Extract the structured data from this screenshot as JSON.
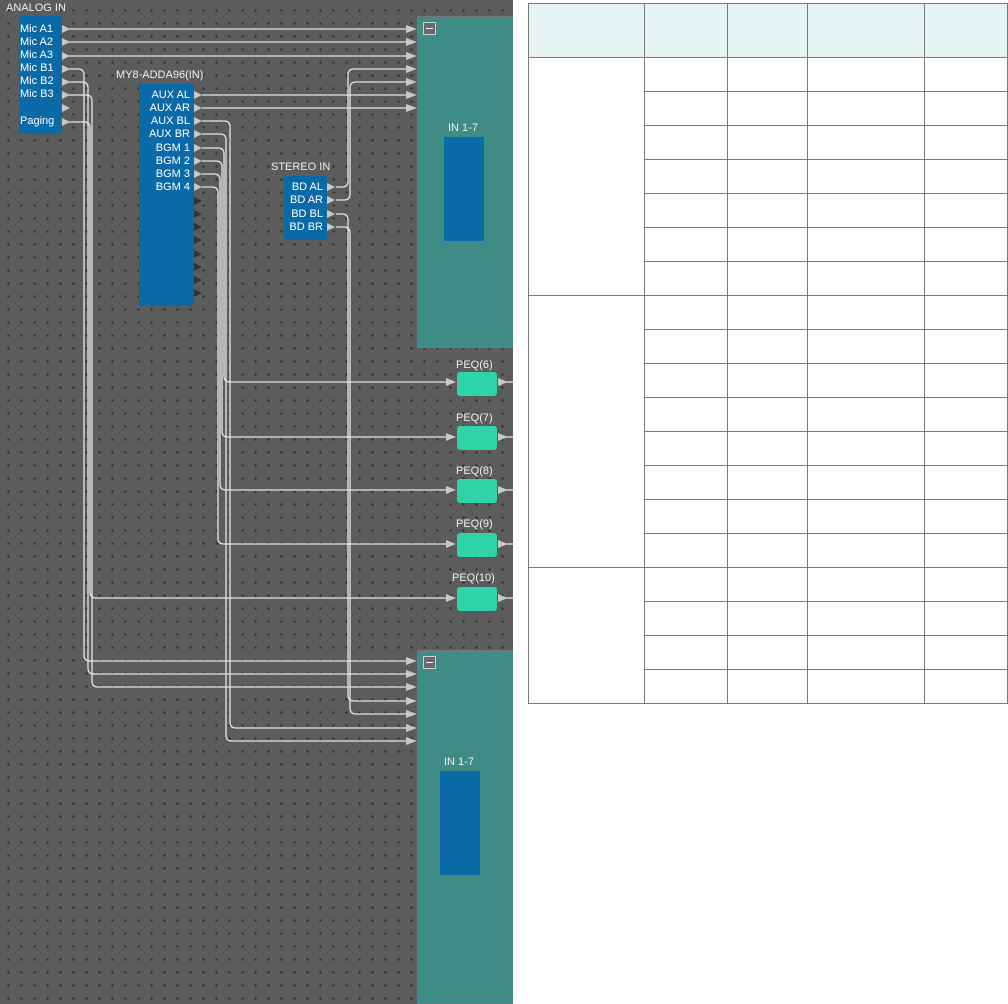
{
  "canvas": {
    "analog_in": {
      "title": "ANALOG IN",
      "ports": [
        "Mic A1",
        "Mic A2",
        "Mic A3",
        "Mic B1",
        "Mic B2",
        "Mic B3",
        "",
        "Paging"
      ]
    },
    "my8": {
      "title": "MY8-ADDA96(IN)",
      "ports": [
        "AUX AL",
        "AUX AR",
        "AUX BL",
        "AUX BR",
        "BGM 1",
        "BGM 2",
        "BGM 3",
        "BGM 4"
      ]
    },
    "stereo_in": {
      "title": "STEREO IN",
      "ports": [
        "BD AL",
        "BD AR",
        "BD BL",
        "BD BR"
      ]
    },
    "dsp_top": {
      "input_label": "IN 1-7"
    },
    "dsp_bottom": {
      "input_label": "IN 1-7"
    },
    "peqs": [
      "PEQ(6)",
      "PEQ(7)",
      "PEQ(8)",
      "PEQ(9)",
      "PEQ(10)"
    ]
  },
  "table": {
    "header": [
      "",
      "",
      "",
      "",
      ""
    ],
    "groups": [
      {
        "label": "",
        "rows": 7
      },
      {
        "label": "",
        "rows": 8
      },
      {
        "label": "",
        "rows": 4
      }
    ]
  },
  "colors": {
    "canvas_bg": "#5c5c5c",
    "block_blue": "#0a6aa8",
    "dsp_teal": "#3f8c86",
    "peq_green": "#2ed3a8",
    "wire": "#e8e8e8",
    "table_header": "#e6f3f3"
  }
}
